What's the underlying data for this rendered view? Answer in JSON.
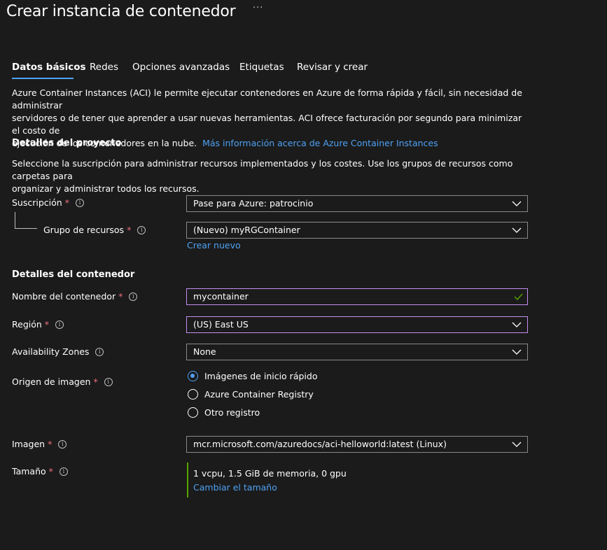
{
  "header": {
    "title": "Crear instancia de contenedor",
    "more": "···"
  },
  "tabs": [
    {
      "label": "Datos básicos"
    },
    {
      "label": "Redes"
    },
    {
      "label": "Opciones avanzadas"
    },
    {
      "label": "Etiquetas"
    },
    {
      "label": "Revisar y crear"
    }
  ],
  "intro": {
    "line1": "Azure Container Instances (ACI) le permite ejecutar contenedores en Azure de forma rápida y fácil, sin necesidad de administrar",
    "line2": "servidores o de tener que aprender a usar nuevas herramientas. ACI ofrece facturación por segundo para minimizar el costo de",
    "line3": "ejecución de los contenedores en la nube.",
    "link": "Más información acerca de Azure Container Instances"
  },
  "project": {
    "heading": "Detalles del proyecto",
    "desc1": "Seleccione la suscripción para administrar recursos implementados y los costes. Use los grupos de recursos como carpetas para",
    "desc2": "organizar y administrar todos los recursos.",
    "subscription_label": "Suscripción",
    "subscription_value": "Pase para Azure: patrocinio",
    "rg_label": "Grupo de recursos",
    "rg_value": "(Nuevo) myRGContainer",
    "rg_create_new": "Crear nuevo"
  },
  "container": {
    "heading": "Detalles del contenedor",
    "name_label": "Nombre del contenedor",
    "name_value": "mycontainer",
    "region_label": "Región",
    "region_value": "(US) East US",
    "az_label": "Availability Zones",
    "az_value": "None",
    "image_source_label": "Origen de imagen",
    "image_source_options": [
      {
        "label": "Imágenes de inicio rápido",
        "selected": true
      },
      {
        "label": "Azure Container Registry",
        "selected": false
      },
      {
        "label": "Otro registro",
        "selected": false
      }
    ],
    "image_label": "Imagen",
    "image_value": "mcr.microsoft.com/azuredocs/aci-helloworld:latest (Linux)",
    "size_label": "Tamaño",
    "size_value": "1 vcpu, 1.5 GiB de memoria, 0 gpu",
    "size_change": "Cambiar el tamaño"
  },
  "common": {
    "required_mark": "*",
    "info_glyph": "i"
  },
  "colors": {
    "background": "#1b1b1b",
    "link": "#4ea1f3",
    "required": "#f1707b",
    "focus_border": "#c38ff0",
    "valid": "#57a300"
  }
}
